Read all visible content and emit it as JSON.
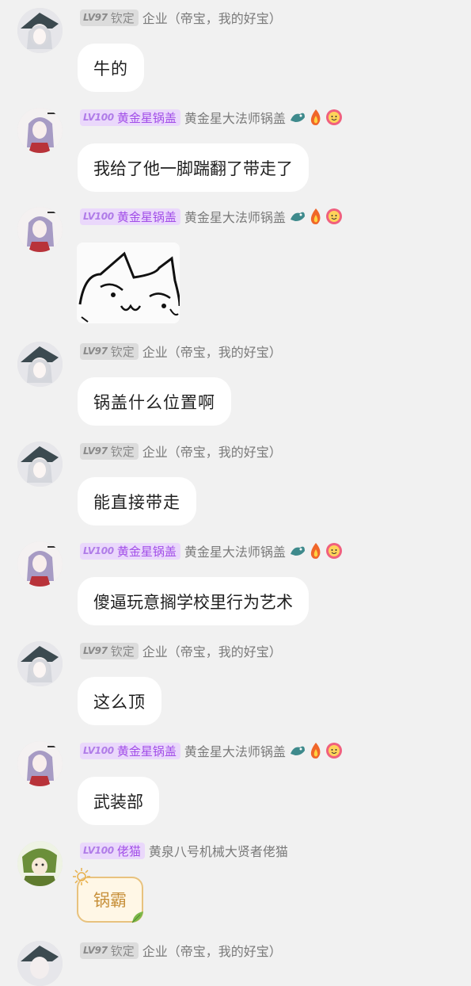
{
  "messages": [
    {
      "user": "钦定",
      "level": "LV97",
      "title": "企业（帝宝，我的好宝）",
      "text": "牛的",
      "avatar": "hat-girl",
      "badge_color": "gray"
    },
    {
      "user": "黄金星锅盖",
      "level": "LV100",
      "title": "黄金星大法师锅盖",
      "text": "我给了他一脚踹翻了带走了",
      "avatar": "purple-girl",
      "badge_color": "purple",
      "emojis": [
        "dragon-icon",
        "fire-icon",
        "smile-icon"
      ]
    },
    {
      "user": "黄金星锅盖",
      "level": "LV100",
      "title": "黄金星大法师锅盖",
      "sticker": "cat-face-sticker",
      "avatar": "purple-girl",
      "badge_color": "purple",
      "emojis": [
        "dragon-icon",
        "fire-icon",
        "smile-icon"
      ]
    },
    {
      "user": "钦定",
      "level": "LV97",
      "title": "企业（帝宝，我的好宝）",
      "text": "锅盖什么位置啊",
      "avatar": "hat-girl",
      "badge_color": "gray"
    },
    {
      "user": "钦定",
      "level": "LV97",
      "title": "企业（帝宝，我的好宝）",
      "text": "能直接带走",
      "avatar": "hat-girl",
      "badge_color": "gray"
    },
    {
      "user": "黄金星锅盖",
      "level": "LV100",
      "title": "黄金星大法师锅盖",
      "text": "傻逼玩意搁学校里行为艺术",
      "avatar": "purple-girl",
      "badge_color": "purple",
      "emojis": [
        "dragon-icon",
        "fire-icon",
        "smile-icon"
      ]
    },
    {
      "user": "钦定",
      "level": "LV97",
      "title": "企业（帝宝，我的好宝）",
      "text": "这么顶",
      "avatar": "hat-girl",
      "badge_color": "gray"
    },
    {
      "user": "黄金星锅盖",
      "level": "LV100",
      "title": "黄金星大法师锅盖",
      "text": "武装部",
      "avatar": "purple-girl",
      "badge_color": "purple",
      "emojis": [
        "dragon-icon",
        "fire-icon",
        "smile-icon"
      ]
    },
    {
      "user": "佬猫",
      "level": "LV100",
      "title": "黄泉八号机械大贤者佬猫",
      "gift_text": "锅霸",
      "avatar": "green-girl",
      "badge_color": "purple"
    },
    {
      "user": "钦定",
      "level": "LV97",
      "title": "企业（帝宝，我的好宝）",
      "avatar": "hat-girl",
      "badge_color": "gray"
    }
  ]
}
